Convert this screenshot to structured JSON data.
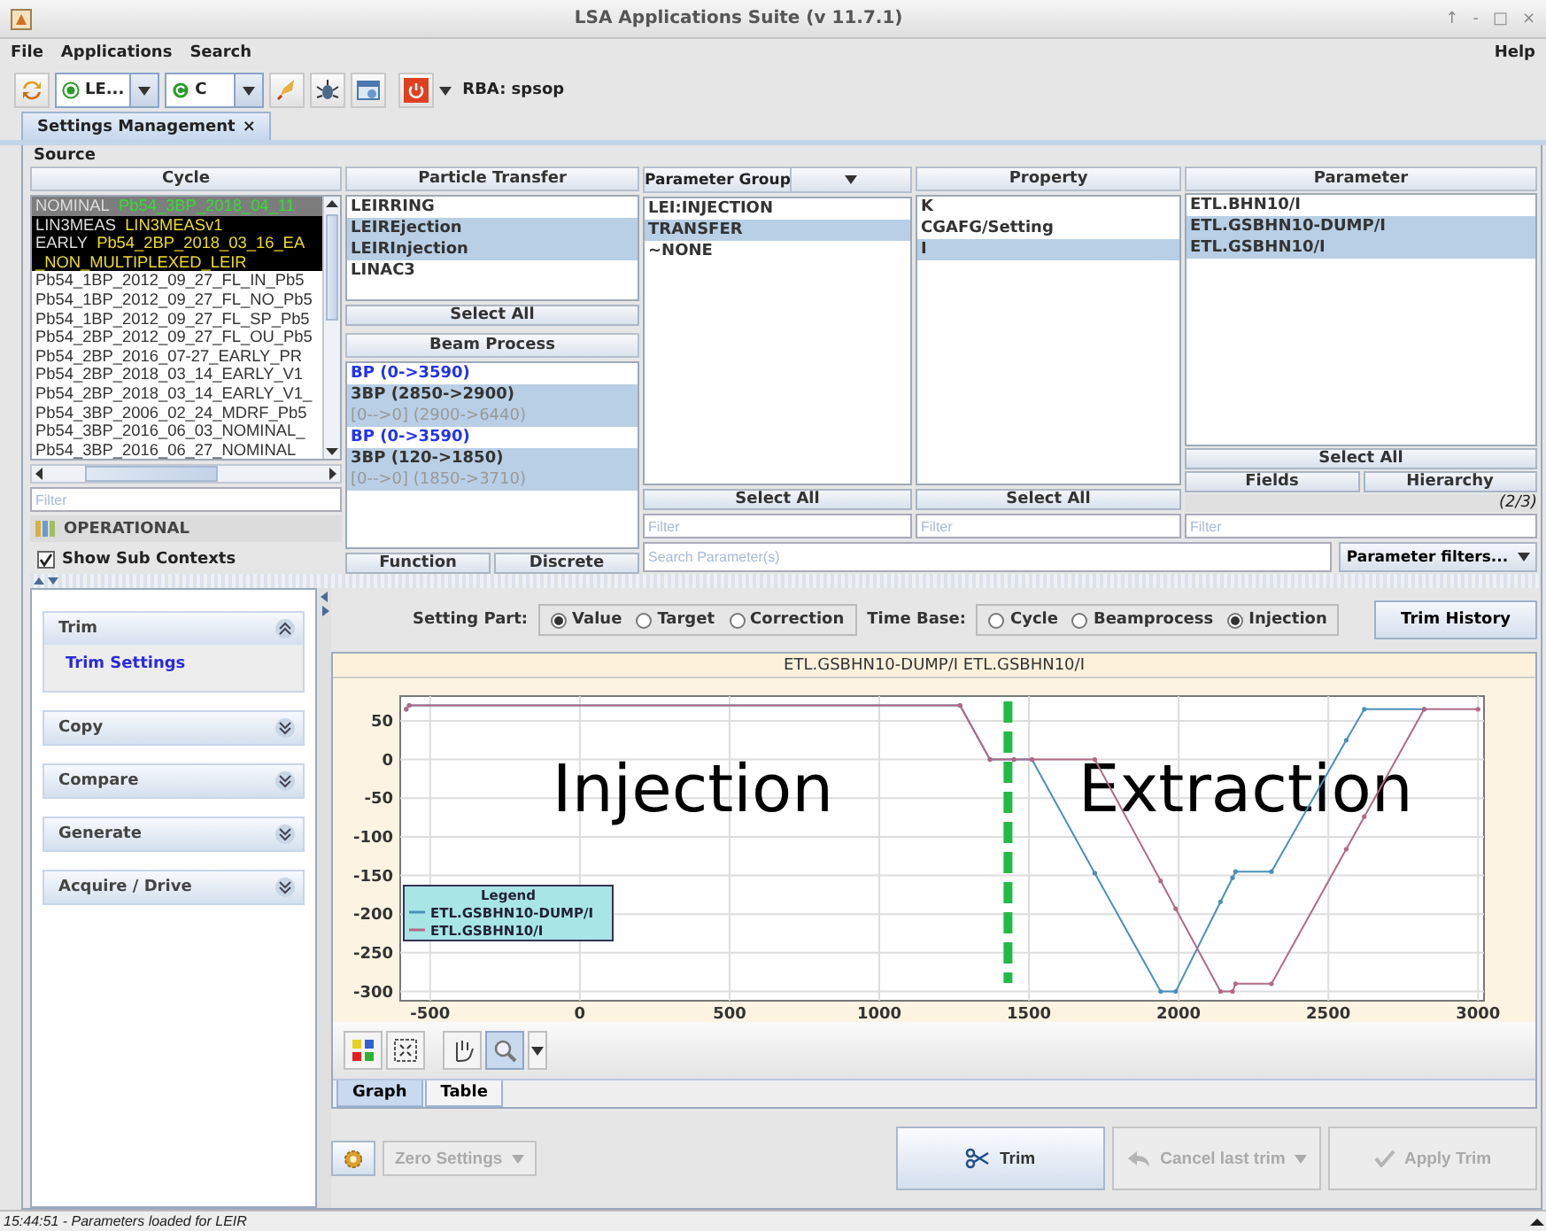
{
  "window": {
    "title": "LSA Applications Suite (v 11.7.1)",
    "controls": [
      "↑",
      "‐",
      "□",
      "×"
    ]
  },
  "menu": {
    "items": [
      "File",
      "Applications",
      "Search"
    ],
    "help": "Help"
  },
  "toolbar": {
    "context_combo": "LE...",
    "cycle_combo": "C",
    "rba": "RBA: spsop"
  },
  "tabs": [
    {
      "label": "Settings Management",
      "close": "×",
      "selected": true
    }
  ],
  "source": {
    "title": "Source",
    "cycle": {
      "header": "Cycle",
      "rows": [
        {
          "kind": "context",
          "context": "NOMINAL",
          "user": "Pb54_3BP_2018_04_11",
          "color": "#33dd33",
          "selected": true
        },
        {
          "kind": "context",
          "context": "LIN3MEAS",
          "user": "LIN3MEASv1",
          "color": "#eedd22",
          "selected": false
        },
        {
          "kind": "context",
          "context": "EARLY",
          "user": "Pb54_2BP_2018_03_16_EA",
          "continuation": "_NON_MULTIPLEXED_LEIR",
          "color": "#eedd22",
          "selected": false
        },
        {
          "kind": "plain",
          "text": "Pb54_1BP_2012_09_27_FL_IN_Pb5",
          "selected": false
        },
        {
          "kind": "plain",
          "text": "Pb54_1BP_2012_09_27_FL_NO_Pb5",
          "selected": false
        },
        {
          "kind": "plain",
          "text": "Pb54_1BP_2012_09_27_FL_SP_Pb5",
          "selected": false
        },
        {
          "kind": "plain",
          "text": "Pb54_2BP_2012_09_27_FL_OU_Pb5",
          "selected": false
        },
        {
          "kind": "plain",
          "text": "Pb54_2BP_2016_07-27_EARLY_PR",
          "selected": false
        },
        {
          "kind": "plain",
          "text": "Pb54_2BP_2018_03_14_EARLY_V1",
          "selected": false
        },
        {
          "kind": "plain",
          "text": "Pb54_2BP_2018_03_14_EARLY_V1_",
          "selected": false
        },
        {
          "kind": "plain",
          "text": "Pb54_3BP_2006_02_24_MDRF_Pb5",
          "selected": false
        },
        {
          "kind": "plain",
          "text": "Pb54_3BP_2016_06_03_NOMINAL_",
          "selected": false
        },
        {
          "kind": "plain",
          "text": "Pb54_3BP_2016_06_27_NOMINAL",
          "selected": false
        }
      ],
      "filter_placeholder": "Filter",
      "operational": "OPERATIONAL",
      "show_sub_contexts": {
        "label": "Show Sub Contexts",
        "checked": true
      }
    },
    "particle_transfer": {
      "header": "Particle Transfer",
      "items": [
        {
          "label": "LEIRRING",
          "selected": false
        },
        {
          "label": "LEIREjection",
          "selected": true
        },
        {
          "label": "LEIRInjection",
          "selected": true
        },
        {
          "label": "LINAC3",
          "selected": false
        }
      ],
      "select_all": "Select All"
    },
    "beam_process": {
      "header": "Beam Process",
      "items": [
        {
          "kind": "beam",
          "label": "BP (0->3590)",
          "selected": false
        },
        {
          "kind": "process",
          "label": "3BP (2850->2900)",
          "selected": true
        },
        {
          "kind": "idle",
          "label": "[0-->0] (2900->6440)",
          "selected": true
        },
        {
          "kind": "beam",
          "label": "BP (0->3590)",
          "selected": false
        },
        {
          "kind": "process",
          "label": "3BP (120->1850)",
          "selected": true
        },
        {
          "kind": "idle",
          "label": "[0-->0] (1850->3710)",
          "selected": true
        }
      ],
      "buttons": [
        "Function",
        "Discrete"
      ]
    },
    "parameter_group": {
      "header": "Parameter Group",
      "items": [
        {
          "label": "LEI:INJECTION",
          "selected": false
        },
        {
          "label": "TRANSFER",
          "selected": true
        },
        {
          "label": "~NONE",
          "selected": false
        }
      ],
      "select_all": "Select All",
      "filter_placeholder": "Filter"
    },
    "property": {
      "header": "Property",
      "items": [
        {
          "label": "K",
          "selected": false
        },
        {
          "label": "CGAFG/Setting",
          "selected": false
        },
        {
          "label": "I",
          "selected": true
        }
      ],
      "select_all": "Select All",
      "filter_placeholder": "Filter"
    },
    "parameter": {
      "header": "Parameter",
      "items": [
        {
          "label": "ETL.BHN10/I",
          "selected": false
        },
        {
          "label": "ETL.GSBHN10-DUMP/I",
          "selected": true
        },
        {
          "label": "ETL.GSBHN10/I",
          "selected": true
        }
      ],
      "select_all": "Select All",
      "buttons": [
        "Fields",
        "Hierarchy"
      ],
      "count": "(2/3)",
      "filter_placeholder": "Filter"
    },
    "search": {
      "placeholder": "Search Parameter(s)",
      "filters_button": "Parameter filters..."
    }
  },
  "trim": {
    "sidebar": [
      {
        "title": "Trim",
        "expanded": true,
        "items": [
          "Trim Settings"
        ]
      },
      {
        "title": "Copy",
        "expanded": false
      },
      {
        "title": "Compare",
        "expanded": false
      },
      {
        "title": "Generate",
        "expanded": false
      },
      {
        "title": "Acquire / Drive",
        "expanded": false
      }
    ],
    "setting_part": {
      "label": "Setting Part:",
      "options": [
        {
          "label": "Value",
          "selected": true
        },
        {
          "label": "Target",
          "selected": false
        },
        {
          "label": "Correction",
          "selected": false
        }
      ]
    },
    "time_base": {
      "label": "Time Base:",
      "options": [
        {
          "label": "Cycle",
          "selected": false
        },
        {
          "label": "Beamprocess",
          "selected": false
        },
        {
          "label": "Injection",
          "selected": true
        }
      ]
    },
    "trim_history": "Trim History",
    "chart_panel": {
      "legend_title": "Legend",
      "chart_data": {
        "type": "line",
        "title": "ETL.GSBHN10-DUMP/I ETL.GSBHN10/I",
        "x": [
          -580,
          -570,
          1270,
          1370,
          1450,
          1510,
          1720,
          1940,
          1990,
          2140,
          2180,
          2190,
          2310,
          2560,
          2620,
          2820,
          3000
        ],
        "series": [
          {
            "name": "ETL.GSBHN10-DUMP/I",
            "color": "#4a90b8",
            "values": [
              65,
              70,
              70,
              0,
              0,
              0,
              -147,
              -300,
              -300,
              -184,
              -153,
              -145,
              -145,
              25,
              65,
              65,
              null
            ]
          },
          {
            "name": "ETL.GSBHN10/I",
            "color": "#b06a86",
            "values": [
              65,
              70,
              70,
              0,
              0,
              0,
              0,
              -157,
              -193,
              -300,
              -300,
              -290,
              -290,
              -116,
              -74,
              65,
              65
            ]
          }
        ],
        "xlim": [
          -600,
          3020
        ],
        "ylim": [
          -312,
          82
        ],
        "xticks": [
          -500,
          0,
          500,
          1000,
          1500,
          2000,
          2500,
          3000
        ],
        "yticks": [
          50,
          0,
          -50,
          -100,
          -150,
          -200,
          -250,
          -300
        ],
        "grid": true,
        "legend": "lower left",
        "annotations": [
          "Injection",
          "Extraction"
        ],
        "ref_lines": [
          {
            "axis": "x",
            "value": 1430,
            "color": "#22bb44"
          }
        ]
      }
    },
    "view_tabs": [
      {
        "label": "Graph",
        "selected": true
      },
      {
        "label": "Table",
        "selected": false
      }
    ],
    "actions": [
      {
        "kind": "settings",
        "disabled": false
      },
      {
        "kind": "zero",
        "label": "Zero Settings",
        "disabled": true
      },
      {
        "kind": "trim",
        "label": "Trim",
        "disabled": false
      },
      {
        "kind": "cancel",
        "label": "Cancel last trim",
        "disabled": true
      },
      {
        "kind": "apply",
        "label": "Apply Trim",
        "disabled": true
      }
    ]
  },
  "status_bar": {
    "message": "15:44:51 -  Parameters loaded for LEIR"
  }
}
